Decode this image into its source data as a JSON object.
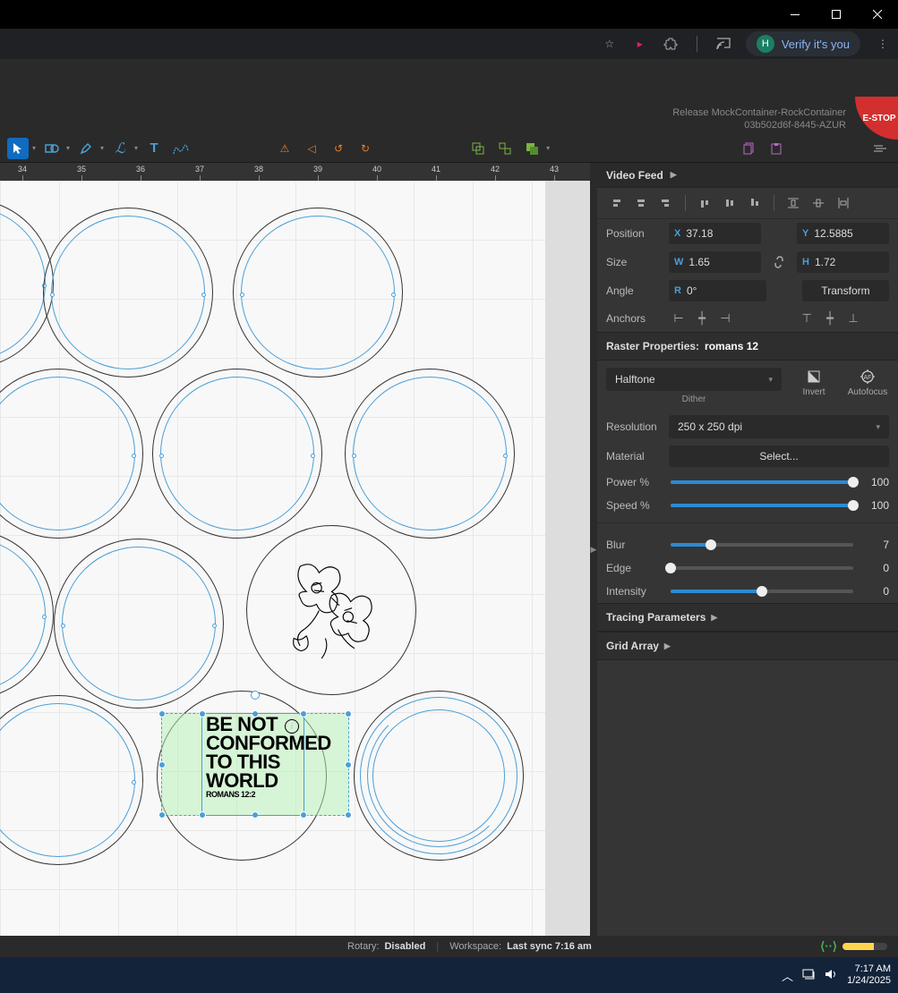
{
  "browser": {
    "verify_label": "Verify it's you",
    "avatar_letter": "H"
  },
  "info_bar": {
    "line1": "Release MockContainer-RockContainer",
    "line2": "03b502d6f-8445-AZUR",
    "estop": "E-STOP"
  },
  "ruler": {
    "ticks": [
      "34",
      "35",
      "36",
      "37",
      "38",
      "39",
      "40",
      "41",
      "42",
      "43"
    ]
  },
  "canvas": {
    "text_object": {
      "line1": "BE NOT",
      "line2": "CONFORMED",
      "line3": "TO THIS",
      "line4": "WORLD",
      "sub": "ROMANS 12:2"
    }
  },
  "panel": {
    "video_feed": "Video Feed",
    "position": {
      "label": "Position",
      "x_prefix": "X",
      "x": "37.18",
      "y_prefix": "Y",
      "y": "12.5885"
    },
    "size": {
      "label": "Size",
      "w_prefix": "W",
      "w": "1.65",
      "h_prefix": "H",
      "h": "1.72"
    },
    "angle": {
      "label": "Angle",
      "r_prefix": "R",
      "value": "0°"
    },
    "transform_btn": "Transform",
    "anchors_label": "Anchors",
    "raster_header": "Raster Properties:",
    "raster_name": "romans 12",
    "dither_mode": "Halftone",
    "dither_label": "Dither",
    "invert_label": "Invert",
    "autofocus_label": "Autofocus",
    "resolution_label": "Resolution",
    "resolution_value": "250 x 250 dpi",
    "material_label": "Material",
    "material_btn": "Select...",
    "sliders": {
      "power": {
        "label": "Power %",
        "value": "100",
        "pct": 100
      },
      "speed": {
        "label": "Speed %",
        "value": "100",
        "pct": 100
      },
      "blur": {
        "label": "Blur",
        "value": "7",
        "pct": 22
      },
      "edge": {
        "label": "Edge",
        "value": "0",
        "pct": 0
      },
      "intensity": {
        "label": "Intensity",
        "value": "0",
        "pct": 50
      }
    },
    "tracing_header": "Tracing Parameters",
    "grid_header": "Grid Array"
  },
  "status": {
    "rotary_label": "Rotary:",
    "rotary_value": "Disabled",
    "workspace_label": "Workspace:",
    "workspace_value": "Last sync 7:16 am"
  },
  "taskbar": {
    "time": "7:17 AM",
    "date": "1/24/2025"
  }
}
